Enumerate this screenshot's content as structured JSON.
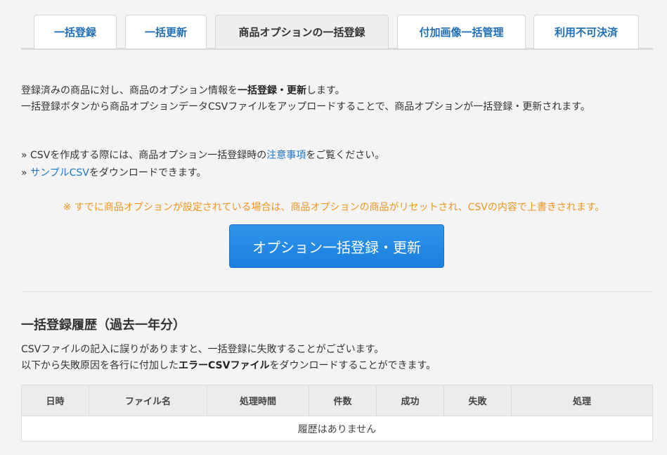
{
  "tabs": [
    {
      "label": "一括登録",
      "active": false
    },
    {
      "label": "一括更新",
      "active": false
    },
    {
      "label": "商品オプションの一括登録",
      "active": true
    },
    {
      "label": "付加画像一括管理",
      "active": false
    },
    {
      "label": "利用不可決済",
      "active": false
    }
  ],
  "intro": {
    "line1_pre": "登録済みの商品に対し、商品のオプション情報を",
    "line1_bold": "一括登録・更新",
    "line1_post": "します。",
    "line2": "一括登録ボタンから商品オプションデータCSVファイルをアップロードすることで、商品オプションが一括登録・更新されます。"
  },
  "links": {
    "bullet": "»",
    "csv_note_pre": "CSVを作成する際には、商品オプション一括登録時の",
    "csv_note_link": "注意事項",
    "csv_note_post": "をご覧ください。",
    "sample_link": "サンプルCSV",
    "sample_post": "をダウンロードできます。"
  },
  "warning": "※ すでに商品オプションが設定されている場合は、商品オプションの商品がリセットされ、CSVの内容で上書きされます。",
  "main_button_label": "オプション一括登録・更新",
  "history": {
    "title": "一括登録履歴（過去一年分）",
    "desc_line1": "CSVファイルの記入に誤りがありますと、一括登録に失敗することがございます。",
    "desc_line2_pre": "以下から失敗原因を各行に付加した",
    "desc_line2_bold": "エラーCSVファイル",
    "desc_line2_post": "をダウンロードすることができます。",
    "columns": [
      "日時",
      "ファイル名",
      "処理時間",
      "件数",
      "成功",
      "失敗",
      "処理"
    ],
    "empty_message": "履歴はありません"
  },
  "colors": {
    "link": "#1f78c8",
    "warning": "#f0961e",
    "button": "#2189e4"
  }
}
